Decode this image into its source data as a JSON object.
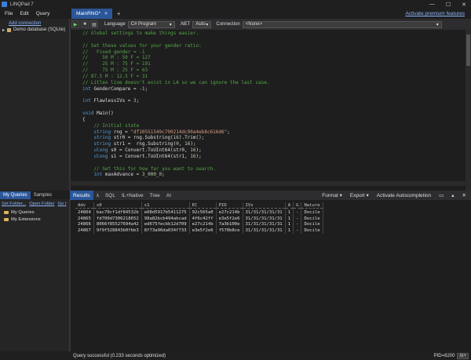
{
  "window": {
    "title": "LINQPad 7",
    "minimize": "—",
    "maximize": "☐",
    "close": "✕"
  },
  "menu": [
    "File",
    "Edit",
    "Query"
  ],
  "tabs": {
    "query_tab": "MainRNG*",
    "close": "×",
    "premium": "Activate premium features"
  },
  "connections": {
    "add": "Add connection",
    "demo": "Demo database (SQLite)"
  },
  "toolbar": {
    "language_label": "Language",
    "language": "C# Program",
    "net_label": ".NET",
    "net": "Auto",
    "connection_label": "Connection",
    "connection": "<None>"
  },
  "code_lines": [
    [
      [
        "cm",
        "// Global settings to make things easier."
      ]
    ],
    [],
    [
      [
        "cm",
        "// Set these values for your gender ratio:"
      ]
    ],
    [
      [
        "cm",
        "//   Fixed gender = -1"
      ]
    ],
    [
      [
        "cm",
        "//     50 M : 50 F = 127"
      ]
    ],
    [
      [
        "cm",
        "//     25 M : 75 F = 191"
      ]
    ],
    [
      [
        "cm",
        "//     75 M : 25 F = 63"
      ]
    ],
    [
      [
        "cm",
        "// 87.5 M : 12.5 F = 31"
      ]
    ],
    [
      [
        "cm",
        "// Litleo line doesn't exist in LA so we can ignore the last case."
      ]
    ],
    [
      [
        "kw",
        "int"
      ],
      [
        "id",
        " GenderCompare = "
      ],
      [
        "num",
        "-1"
      ],
      [
        "id",
        ";"
      ]
    ],
    [],
    [
      [
        "kw",
        "int"
      ],
      [
        "id",
        " FlawlessIVs = "
      ],
      [
        "num",
        "3"
      ],
      [
        "id",
        ";"
      ]
    ],
    [],
    [
      [
        "kw",
        "void"
      ],
      [
        "id",
        " Main()"
      ]
    ],
    [
      [
        "id",
        "{"
      ]
    ],
    [
      [
        "cm",
        "    // Initial state"
      ]
    ],
    [
      [
        "kw",
        "    string"
      ],
      [
        "id",
        " rng = "
      ],
      [
        "str",
        "\"df10551549c790214dc90a4eb8c616d6\""
      ],
      [
        "id",
        ";"
      ]
    ],
    [
      [
        "kw",
        "    string"
      ],
      [
        "id",
        " str0 = rng.Substring("
      ],
      [
        "num",
        "16"
      ],
      [
        "id",
        ").Trim();"
      ]
    ],
    [
      [
        "kw",
        "    string"
      ],
      [
        "id",
        " str1 =  rng.Substring("
      ],
      [
        "num",
        "0"
      ],
      [
        "id",
        ", "
      ],
      [
        "num",
        "16"
      ],
      [
        "id",
        ");"
      ]
    ],
    [
      [
        "kw",
        "    ulong"
      ],
      [
        "id",
        " s0 = Convert.ToUInt64(str0, "
      ],
      [
        "num",
        "16"
      ],
      [
        "id",
        ");"
      ]
    ],
    [
      [
        "kw",
        "    ulong"
      ],
      [
        "id",
        " s1 = Convert.ToUInt64(str1, "
      ],
      [
        "num",
        "16"
      ],
      [
        "id",
        ");"
      ]
    ],
    [],
    [
      [
        "cm",
        "    // Set this for how far you want to search."
      ]
    ],
    [
      [
        "kw",
        "    int"
      ],
      [
        "id",
        " maxAdvance = "
      ],
      [
        "num",
        "3_000_0"
      ],
      [
        "id",
        ";"
      ]
    ]
  ],
  "left_tabs": {
    "my_queries": "My Queries",
    "samples": "Samples"
  },
  "left_links": {
    "set_folder": "Set Folder...",
    "open_folder": "Open Folder",
    "go": "Go t"
  },
  "folders": {
    "my_queries": "My Queries",
    "my_extensions": "My Extensions"
  },
  "result_tabs": [
    "Results",
    "λ",
    "SQL",
    "IL+Native",
    "Tree",
    "AI"
  ],
  "result_actions": {
    "format": "Format ▾",
    "export": "Export ▾",
    "autocomplete": "Activate Autocompletion"
  },
  "table": {
    "headers": [
      "Adv",
      "s0",
      "s1",
      "EC",
      "PID",
      "IVs",
      "A",
      "G",
      "Nature"
    ],
    "rows": [
      [
        "24864",
        "bac70cf1df84532b",
        "e08d5917b5411275",
        "92c565a0",
        "e27c214b",
        "31/31/31/31/31",
        "1",
        "-",
        "Docile"
      ],
      [
        "24865",
        "fd700d7306218652",
        "98a82bcb494abcad",
        "4f6c42ff",
        "e3e5f2e6",
        "31/31/31/31/31",
        "1",
        "-",
        "Docile"
      ],
      [
        "24866",
        "8066f85527694a42",
        "ed675fecbb12d709",
        "e27c214b",
        "7a3b100e",
        "31/31/31/31/31",
        "1",
        "-",
        "Docile"
      ],
      [
        "24867",
        "9f9f528843b0fbb3",
        "8f73a96da034f733",
        "e3e5f2e6",
        "f570b8ce",
        "31/31/31/31/31",
        "1",
        "-",
        "Docile"
      ]
    ]
  },
  "status": {
    "text": "Query successful  (0.233 seconds optimized)",
    "pid": "PID=8200",
    "lang": "/o+"
  }
}
